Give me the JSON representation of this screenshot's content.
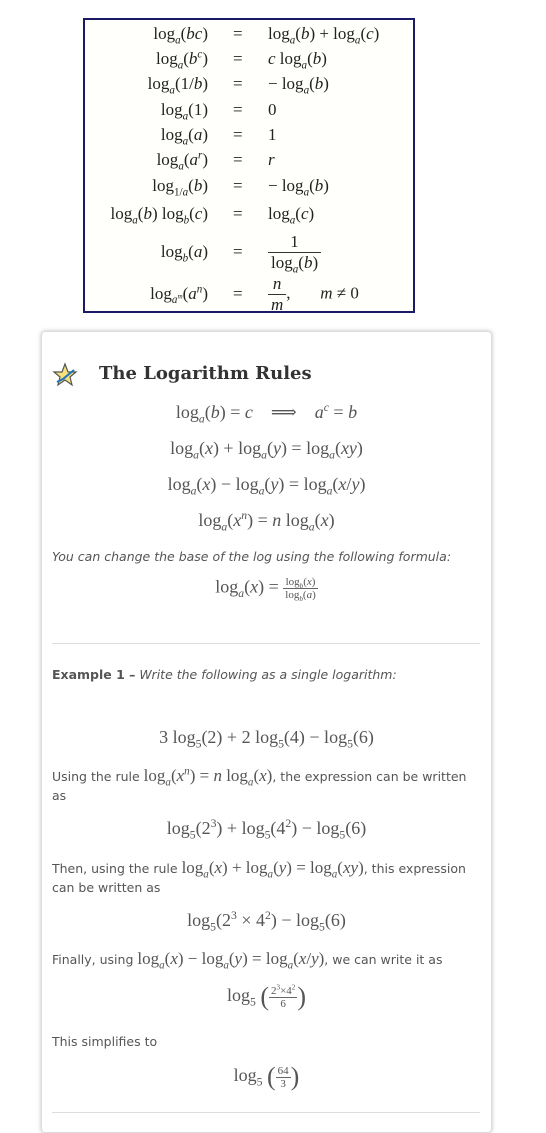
{
  "identity_table": {
    "rows": [
      {
        "lhs": "log_a(bc)",
        "rhs": "log_a(b) + log_a(c)"
      },
      {
        "lhs": "log_a(b^c)",
        "rhs": "c log_a(b)"
      },
      {
        "lhs": "log_a(1/b)",
        "rhs": "− log_a(b)"
      },
      {
        "lhs": "log_a(1)",
        "rhs": "0"
      },
      {
        "lhs": "log_a(a)",
        "rhs": "1"
      },
      {
        "lhs": "log_a(a^r)",
        "rhs": "r"
      },
      {
        "lhs": "log_1/a(b)",
        "rhs": "− log_a(b)"
      },
      {
        "lhs": "log_a(b) log_b(c)",
        "rhs": "log_a(c)"
      },
      {
        "lhs": "log_b(a)",
        "rhs": "1 / log_a(b)"
      },
      {
        "lhs": "log_a^m(a^n)",
        "rhs": "n/m,   m ≠ 0"
      }
    ],
    "equals": "="
  },
  "card": {
    "title": "The Logarithm Rules",
    "icon": "star-check-icon",
    "rules": [
      "log_a(b) = c ⟹ a^c = b",
      "log_a(x) + log_a(y) = log_a(xy)",
      "log_a(x) − log_a(y) = log_a(x/y)",
      "log_a(x^n) = n log_a(x)"
    ],
    "change_base_text": "You can change the base of the log using the following formula:",
    "change_base_formula": "log_a(x) = log_b(x) / log_b(a)",
    "example": {
      "label": "Example 1 –",
      "prompt": "Write the following as a single logarithm:",
      "expression": "3 log_5(2) + 2 log_5(4) − log_5(6)",
      "step1_prefix": "Using the rule",
      "step1_rule": "log_a(x^n) = n log_a(x)",
      "step1_suffix": ", the expression can be written as",
      "step1_result": "log_5(2^3) + log_5(4^2) − log_5(6)",
      "step2_prefix": "Then, using the rule",
      "step2_rule": "log_a(x) + log_a(y) = log_a(xy)",
      "step2_suffix": ", this expression can be written as",
      "step2_result": "log_5(2^3 × 4^2) − log_5(6)",
      "step3_prefix": "Finally, using",
      "step3_rule": "log_a(x) − log_a(y) = log_a(x/y)",
      "step3_suffix": ", we can write it as",
      "step3_result": "log_5((2^3 × 4^2)/6)",
      "step4_text": "This simplifies to",
      "step4_result": "log_5(64/3)"
    }
  }
}
